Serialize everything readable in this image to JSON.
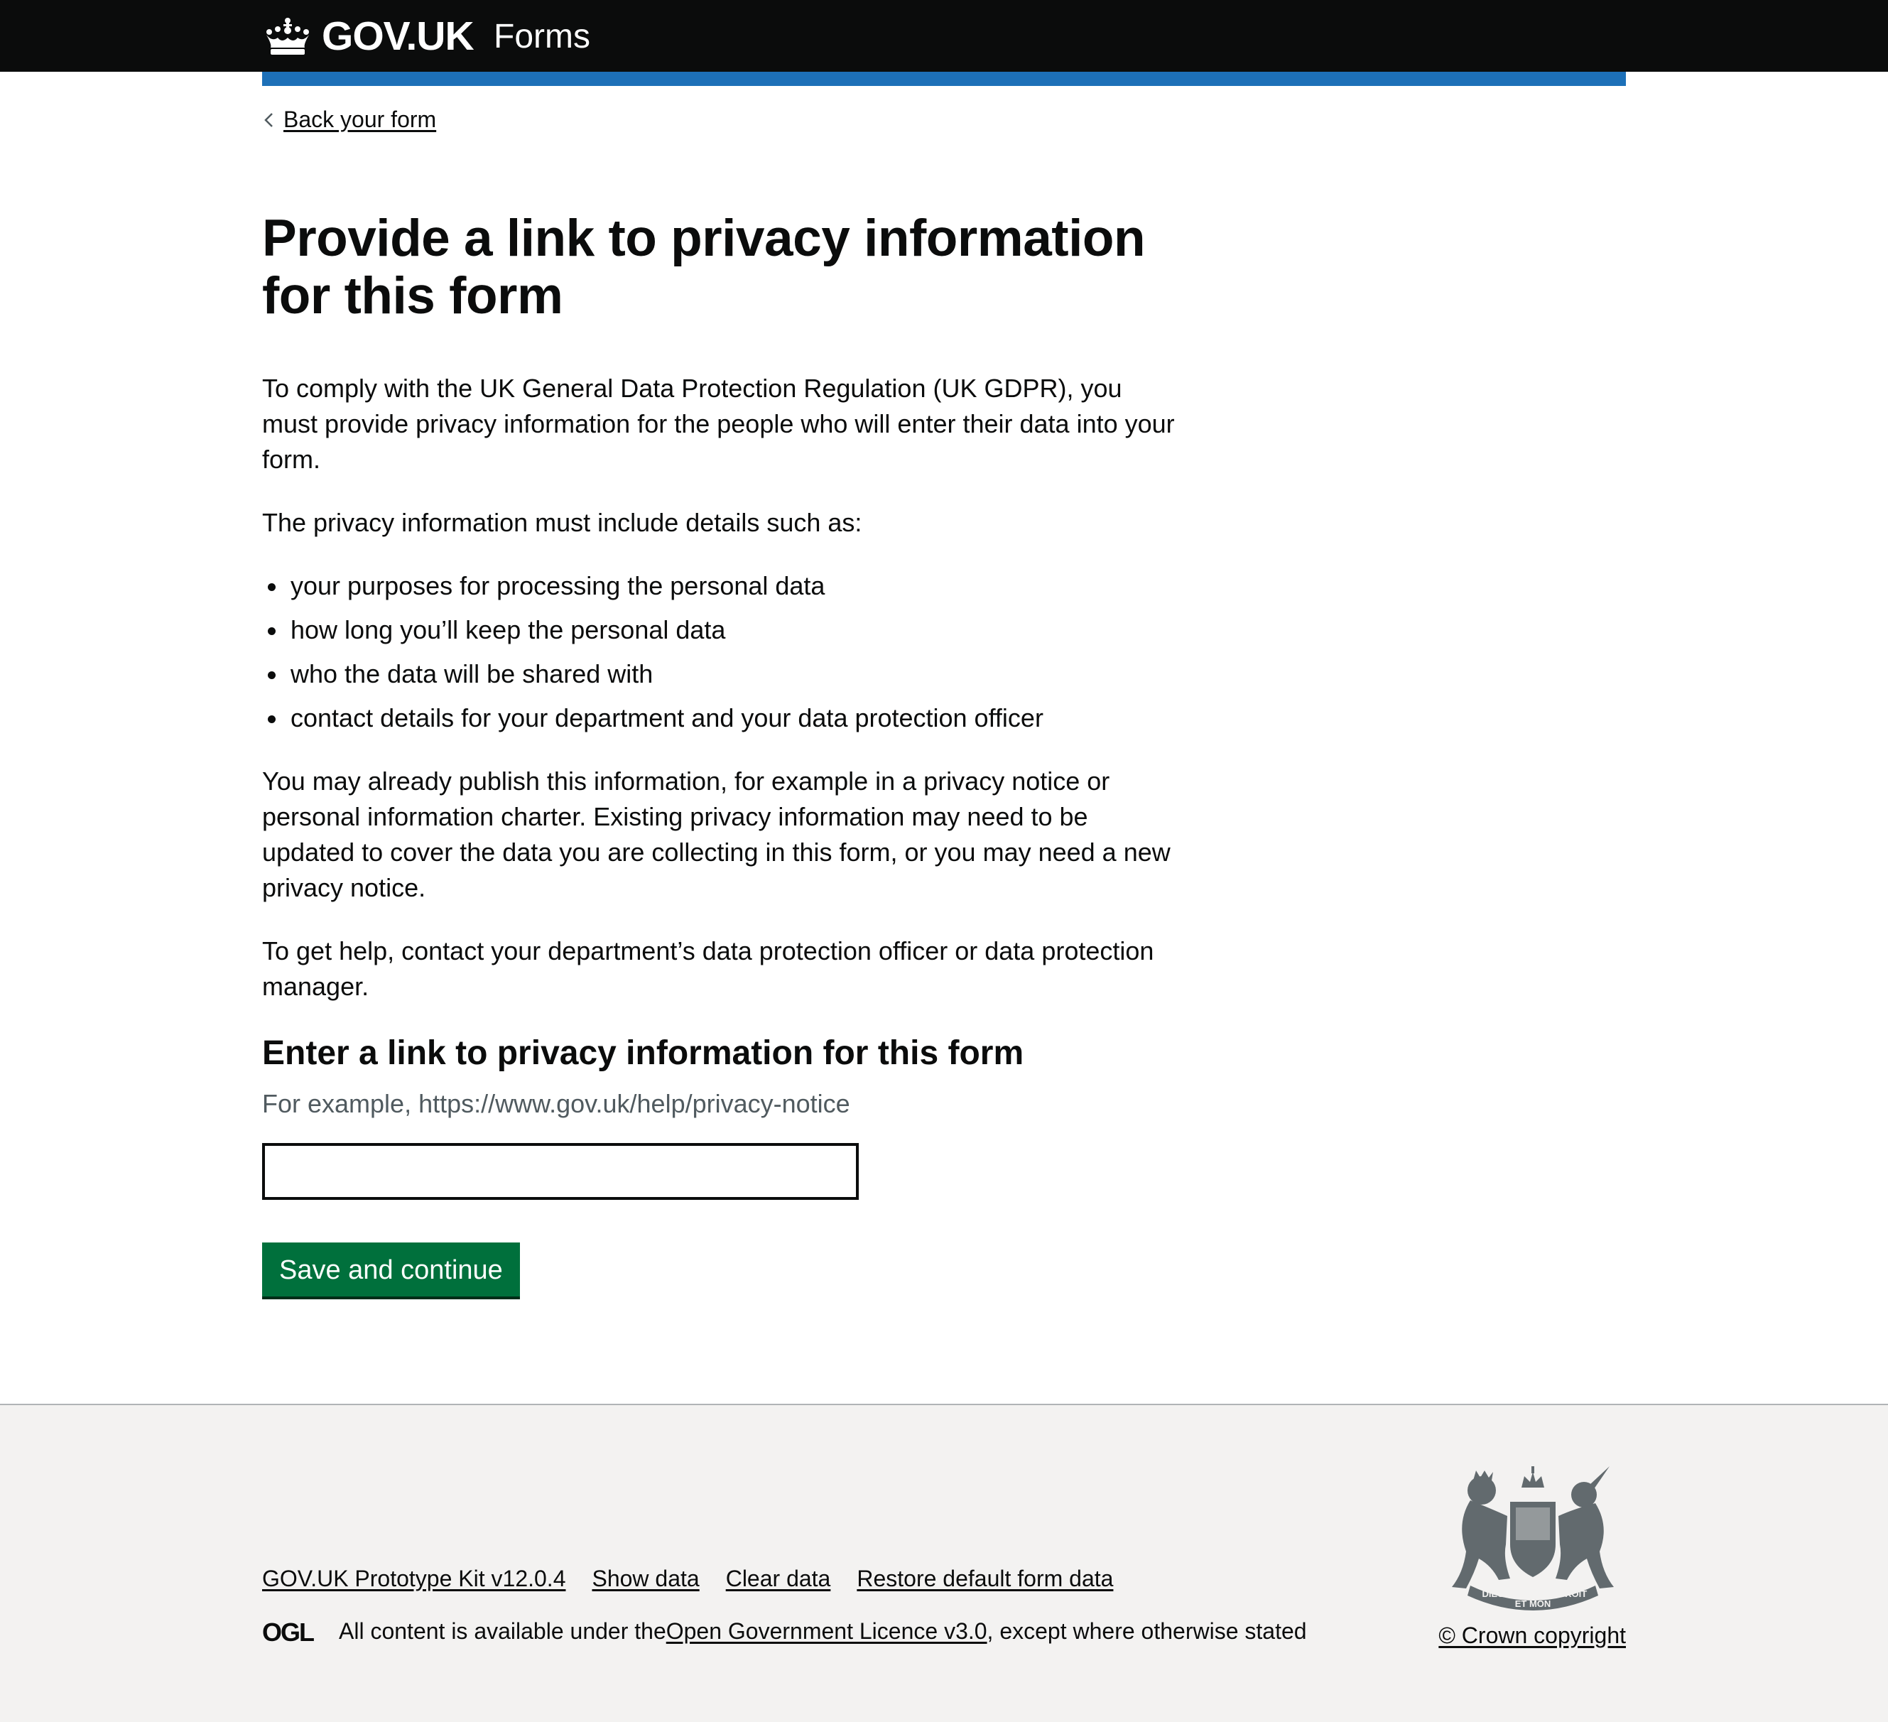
{
  "header": {
    "logo_text": "GOV.UK",
    "service_name": "Forms",
    "brand_color": "#0b0c0c",
    "accent_color": "#1d70b8"
  },
  "back_link": {
    "label": "Back your form"
  },
  "main": {
    "title": "Provide a link to privacy information for this form",
    "para1": "To comply with the UK General Data Protection Regulation (UK GDPR), you must provide privacy information for the people who will enter their data into your form.",
    "para2": "The privacy information must include details such as:",
    "bullets": [
      "your purposes for processing the personal data",
      "how long you’ll keep the personal data",
      "who the data will be shared with",
      "contact details for your department and your data protection officer"
    ],
    "para3": "You may already publish this information, for example in a privacy notice or personal information charter. Existing privacy information may need to be updated to cover the data you are collecting in this form, or you may need a new privacy notice.",
    "para4": "To get help, contact your department’s data protection officer or data protection manager.",
    "field_label": "Enter a link to privacy information for this form",
    "field_hint": "For example, https://www.gov.uk/help/privacy-notice",
    "field_value": "",
    "submit_label": "Save and continue",
    "button_color": "#00703c"
  },
  "footer": {
    "links": [
      "GOV.UK Prototype Kit v12.0.4",
      "Show data",
      "Clear data",
      "Restore default form data"
    ],
    "licence_prefix": "All content is available under the ",
    "licence_link": "Open Government Licence v3.0",
    "licence_suffix": ", except where otherwise stated",
    "copyright": "© Crown copyright",
    "crest_motto_1": "DIEU",
    "crest_motto_2": "ET MON",
    "crest_motto_3": "DROIT",
    "ogl_text": "OGL"
  },
  "icons": {
    "crown": "crown-icon",
    "back": "chevron-left-icon",
    "ogl": "ogl-logo",
    "crest": "royal-coat-of-arms"
  }
}
